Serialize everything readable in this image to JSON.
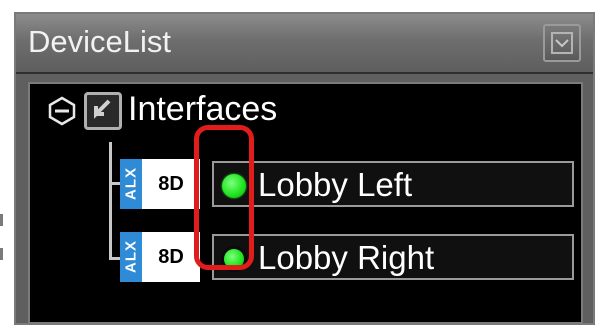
{
  "panel": {
    "title": "DeviceList",
    "collapse_icon": "collapse-box-icon"
  },
  "tree": {
    "root": {
      "label": "Interfaces",
      "expander_icon": "collapse-minus-icon",
      "node_icon": "interfaces-folder-icon",
      "expanded": true
    },
    "devices": [
      {
        "brand": "ALX",
        "type": "8D",
        "name": "Lobby Left",
        "status_color": "#22e622",
        "status_icon": "status-led-icon"
      },
      {
        "brand": "ALX",
        "type": "8D",
        "name": "Lobby Right",
        "status_color": "#22e622",
        "status_icon": "status-led-icon"
      }
    ]
  },
  "colors": {
    "panel_bg": "#5f5f5f",
    "tree_bg": "#000000",
    "brand_blue": "#2f8bd6",
    "status_green": "#22e622",
    "highlight_red": "#e21b1b"
  }
}
